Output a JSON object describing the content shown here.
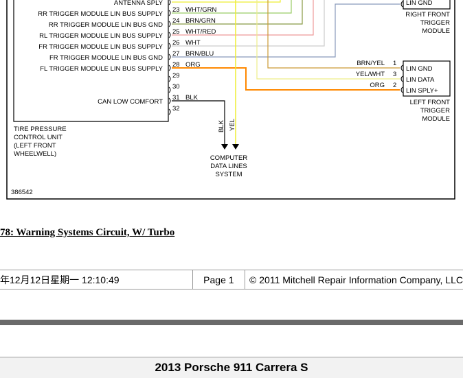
{
  "diagram": {
    "tpms_labels": [
      "ANTENNA SPLY",
      "RR TRIGGER MODULE LIN BUS SUPPLY",
      "RR TRIGGER MODULE LIN BUS GND",
      "RL TRIGGER MODULE LIN BUS SUPPLY",
      "FR TRIGGER MODULE LIN BUS SUPPLY",
      "FR TRIGGER MODULE LIN BUS GND",
      "FL TRIGGER MODULE LIN BUS SUPPLY"
    ],
    "pins": [
      "23",
      "24",
      "25",
      "26",
      "27",
      "28",
      "29",
      "30",
      "31",
      "32"
    ],
    "wires": [
      "WHT/GRN",
      "BRN/GRN",
      "WHT/RED",
      "WHT",
      "BRN/BLU",
      "ORG",
      "BLK"
    ],
    "can_label": "CAN LOW COMFORT",
    "module_name": [
      "TIRE PRESSURE",
      "CONTROL UNIT",
      "(LEFT FRONT",
      "WHEELWELL)"
    ],
    "right_front": {
      "pin_label": "LIN GND",
      "name": [
        "RIGHT FRONT",
        "TRIGGER",
        "MODULE"
      ]
    },
    "left_front": {
      "pin_labels": [
        "LIN GND",
        "LIN DATA",
        "LIN SPLY+"
      ],
      "wires": [
        "BRN/YEL",
        "YEL/WHT",
        "ORG"
      ],
      "pins": [
        "1",
        "3",
        "2"
      ],
      "name": [
        "LEFT FRONT",
        "TRIGGER",
        "MODULE"
      ]
    },
    "vertical_wires": [
      "BLK",
      "YEL"
    ],
    "computer": [
      "COMPUTER",
      "DATA LINES",
      "SYSTEM"
    ],
    "figure_id": "386542"
  },
  "caption": "78: Warning Systems Circuit, W/ Turbo",
  "footer": {
    "date": "年12月12日星期一  12:10:49",
    "page": "Page 1",
    "copyright": "© 2011 Mitchell Repair Information Company, LLC"
  },
  "bottom_title": "2013 Porsche 911 Carrera S",
  "colors": {
    "yellow": "#eeee33",
    "orange": "#ff8800",
    "white_green": "#99cc66",
    "brown_green": "#889944",
    "white_red": "#ee9999",
    "white": "#cccccc",
    "brown_blue": "#8899bb",
    "brown_yellow": "#cc9933",
    "yellow_white": "#eeee88",
    "black": "#000000"
  }
}
